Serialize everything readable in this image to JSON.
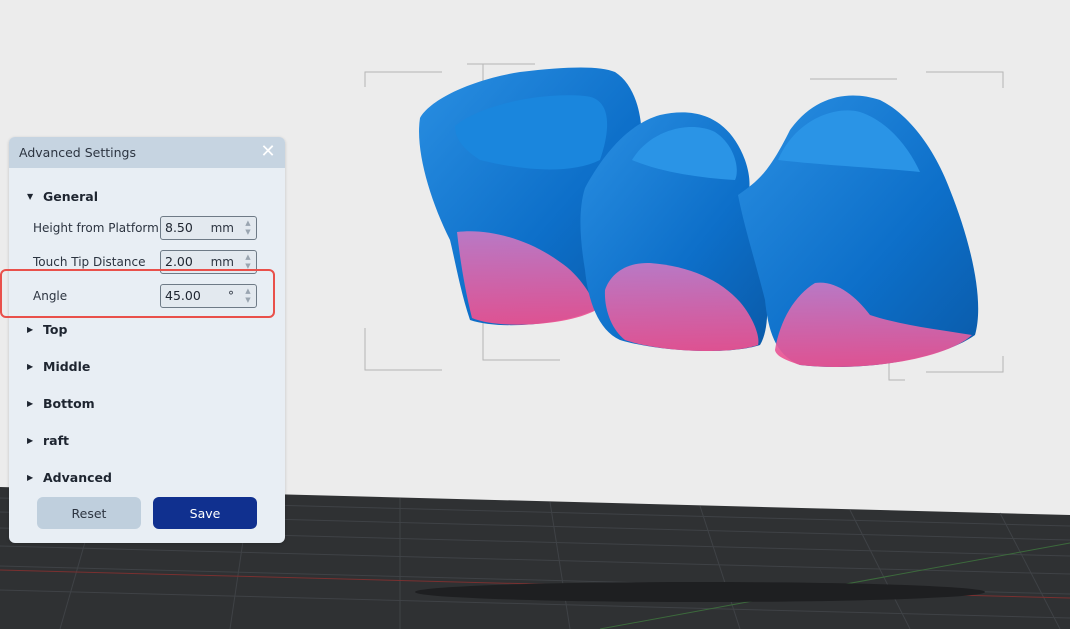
{
  "panel": {
    "title": "Advanced Settings",
    "close_icon": "close-icon",
    "general_label": "General",
    "fields": [
      {
        "label": "Height from Platform",
        "value": "8.50",
        "unit": "mm"
      },
      {
        "label": "Touch Tip Distance",
        "value": "2.00",
        "unit": "mm"
      },
      {
        "label": "Angle",
        "value": "45.00",
        "unit": "°"
      }
    ],
    "sections": [
      "Top",
      "Middle",
      "Bottom",
      "raft",
      "Advanced"
    ],
    "reset_label": "Reset",
    "save_label": "Save"
  },
  "colors": {
    "accent": "#10308f",
    "highlight": "#e9504a",
    "model_blue": "#1e7fd6",
    "model_pink": "#e0609a",
    "background": "#ececec",
    "platform": "#2e3032"
  }
}
